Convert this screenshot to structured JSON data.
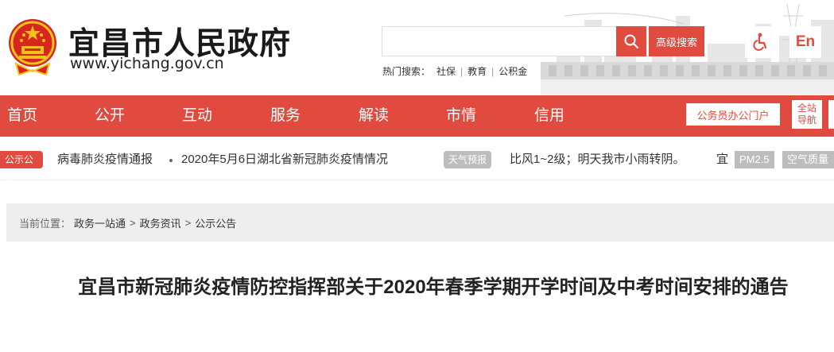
{
  "header": {
    "site_title": "宜昌市人民政府",
    "site_url": "www.yichang.gov.cn",
    "search": {
      "value": "",
      "placeholder": ""
    },
    "advanced_search_label": "高级搜索",
    "hot_search": {
      "label": "热门搜索：",
      "items": [
        "社保",
        "教育",
        "公积金"
      ]
    },
    "english_label": "En"
  },
  "nav": {
    "items": [
      "首页",
      "公开",
      "互动",
      "服务",
      "解读",
      "市情",
      "信用"
    ],
    "portal_label": "公务员办公门户",
    "sitenav_line1": "全站",
    "sitenav_line2": "导航"
  },
  "notice_bar": {
    "notice_tag": "公示公告",
    "items": [
      "病毒肺炎疫情通报",
      "2020年5月6日湖北省新冠肺炎疫情情况"
    ],
    "weather_tag": "天气预报",
    "weather_text": "比风1~2级；明天我市小雨转阴。",
    "weather_extra": "宜",
    "pm_tag": "PM2.5",
    "aq_tag": "空气质量"
  },
  "breadcrumb": {
    "label": "当前位置：",
    "items": [
      "政务一站通",
      "政务资讯",
      "公示公告"
    ]
  },
  "article": {
    "title": "宜昌市新冠肺炎疫情防控指挥部关于2020年春季学期开学时间及中考时间安排的通告"
  },
  "colors": {
    "brand_red": "#e04a3f",
    "tag_gray": "#bdbdbd",
    "breadcrumb_bg": "#eeeeee"
  },
  "icons": {
    "search": "magnifier-icon",
    "accessibility": "wheelchair-icon",
    "emblem": "national-emblem-icon"
  }
}
